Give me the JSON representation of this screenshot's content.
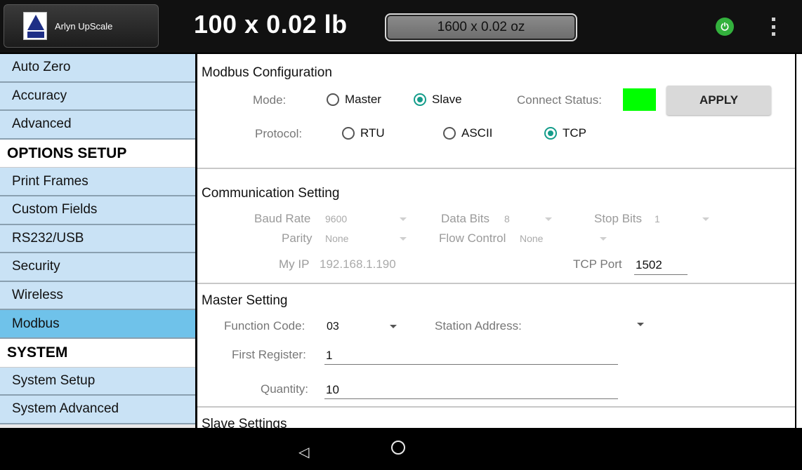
{
  "app": {
    "brand_name": "Arlyn UpScale",
    "logo_icon": "arlyn-logo-icon"
  },
  "header": {
    "primary_weight": "100 x 0.02 lb",
    "alt_weight": "1600 x 0.02 oz",
    "power_icon": "power-icon",
    "menu_icon": "more-vert-icon"
  },
  "sidebar": {
    "items": [
      {
        "label": "Auto Zero",
        "kind": "item"
      },
      {
        "label": "Accuracy",
        "kind": "item"
      },
      {
        "label": "Advanced",
        "kind": "item"
      },
      {
        "label": "OPTIONS SETUP",
        "kind": "header"
      },
      {
        "label": "Print Frames",
        "kind": "item"
      },
      {
        "label": "Custom Fields",
        "kind": "item"
      },
      {
        "label": "RS232/USB",
        "kind": "item"
      },
      {
        "label": "Security",
        "kind": "item"
      },
      {
        "label": "Wireless",
        "kind": "item"
      },
      {
        "label": "Modbus",
        "kind": "item",
        "active": true
      },
      {
        "label": "SYSTEM",
        "kind": "header"
      },
      {
        "label": "System Setup",
        "kind": "item"
      },
      {
        "label": "System Advanced",
        "kind": "item"
      }
    ]
  },
  "modbus": {
    "title": "Modbus Configuration",
    "mode_label": "Mode:",
    "mode_master": "Master",
    "mode_slave": "Slave",
    "mode_selected": "Slave",
    "connect_status_label": "Connect Status:",
    "connect_status_color": "#00ff00",
    "apply_label": "APPLY",
    "protocol_label": "Protocol:",
    "protocol_rtu": "RTU",
    "protocol_ascii": "ASCII",
    "protocol_tcp": "TCP",
    "protocol_selected": "TCP"
  },
  "communication": {
    "title": "Communication Setting",
    "baud_rate_label": "Baud Rate",
    "baud_rate_value": "9600",
    "data_bits_label": "Data Bits",
    "data_bits_value": "8",
    "stop_bits_label": "Stop Bits",
    "stop_bits_value": "1",
    "parity_label": "Parity",
    "parity_value": "None",
    "flow_control_label": "Flow Control",
    "flow_control_value": "None",
    "my_ip_label": "My IP",
    "my_ip_value": "192.168.1.190",
    "tcp_port_label": "TCP Port",
    "tcp_port_value": "1502"
  },
  "master": {
    "title": "Master Setting",
    "function_code_label": "Function Code:",
    "function_code_value": "03",
    "station_address_label": "Station Address:",
    "first_register_label": "First Register:",
    "first_register_value": "1",
    "quantity_label": "Quantity:",
    "quantity_value": "10"
  },
  "slave": {
    "title": "Slave Settings"
  },
  "navbar": {
    "back_icon": "back-icon",
    "home_icon": "home-icon"
  },
  "colors": {
    "accent": "#149c8a",
    "sidebar_item": "#c9e2f5",
    "sidebar_active": "#6fc2ea",
    "power": "#33b13d"
  }
}
